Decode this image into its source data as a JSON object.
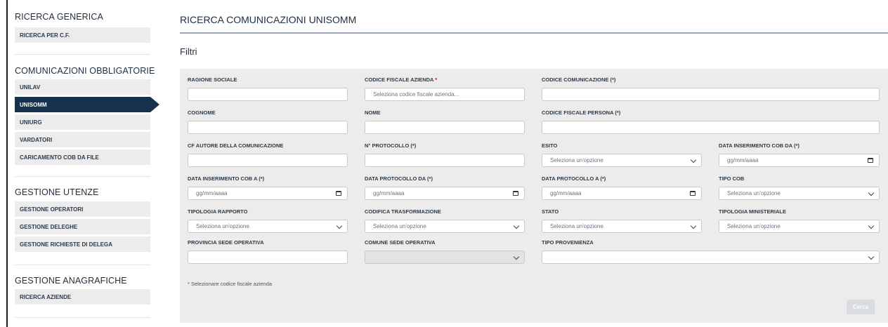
{
  "sidebar": {
    "groups": [
      {
        "title": "RICERCA GENERICA",
        "items": [
          "RICERCA PER C.F."
        ]
      },
      {
        "title": "COMUNICAZIONI OBBLIGATORIE",
        "items": [
          "UNILAV",
          "UNISOMM",
          "UNIURG",
          "VARDATORI",
          "CARICAMENTO COB DA FILE"
        ]
      },
      {
        "title": "GESTIONE UTENZE",
        "items": [
          "GESTIONE OPERATORI",
          "GESTIONE DELEGHE",
          "GESTIONE RICHIESTE DI DELEGA"
        ]
      },
      {
        "title": "GESTIONE ANAGRAFICHE",
        "items": [
          "RICERCA AZIENDE"
        ]
      }
    ],
    "active_item": "UNISOMM"
  },
  "main": {
    "page_title": "RICERCA COMUNICAZIONI UNISOMM",
    "filters_title": "Filtri",
    "fields": {
      "ragione_sociale": {
        "label": "RAGIONE SOCIALE",
        "value": ""
      },
      "codice_fiscale_azienda": {
        "label": "CODICE FISCALE AZIENDA",
        "required_mark": "*",
        "placeholder": "Seleziona codice fiscale azienda..."
      },
      "codice_comunicazione": {
        "label": "CODICE COMUNICAZIONE (*)",
        "value": ""
      },
      "cognome": {
        "label": "COGNOME",
        "value": ""
      },
      "nome": {
        "label": "NOME",
        "value": ""
      },
      "codice_fiscale_persona": {
        "label": "CODICE FISCALE PERSONA (*)",
        "value": ""
      },
      "cf_autore": {
        "label": "CF AUTORE DELLA COMUNICAZIONE",
        "value": ""
      },
      "n_protocollo": {
        "label": "N° PROTOCOLLO (*)",
        "value": ""
      },
      "esito": {
        "label": "ESITO",
        "value": "Seleziona un'opzione"
      },
      "data_ins_da": {
        "label": "DATA INSERIMENTO COB DA (*)",
        "value": "gg/mm/aaaa"
      },
      "data_ins_a": {
        "label": "DATA INSERIMENTO COB A (*)",
        "value": "gg/mm/aaaa"
      },
      "data_prot_da": {
        "label": "DATA PROTOCOLLO DA (*)",
        "value": "gg/mm/aaaa"
      },
      "data_prot_a": {
        "label": "DATA PROTOCOLLO A (*)",
        "value": "gg/mm/aaaa"
      },
      "tipo_cob": {
        "label": "TIPO COB",
        "value": "Seleziona un'opzione"
      },
      "tipologia_rapporto": {
        "label": "TIPOLOGIA RAPPORTO",
        "value": "Seleziona un'opzione"
      },
      "codifica_trasformazione": {
        "label": "CODIFICA TRASFORMAZIONE",
        "value": "Seleziona un'opzione"
      },
      "stato": {
        "label": "STATO",
        "value": "Seleziona un'opzione"
      },
      "tipologia_ministeriale": {
        "label": "TIPOLOGIA MINISTERIALE",
        "value": "Seleziona un'opzione"
      },
      "provincia_sede": {
        "label": "PROVINCIA SEDE OPERATIVA",
        "value": ""
      },
      "comune_sede": {
        "label": "COMUNE SEDE OPERATIVA",
        "value": ""
      },
      "tipo_provenienza": {
        "label": "TIPO PROVENIENZA",
        "value": ""
      }
    },
    "note": "* Selezionare codice fiscale azienda",
    "search_button": "Cerca"
  },
  "colors": {
    "active_nav": "#17324d",
    "panel_bg": "#ececec",
    "required": "#d0021b"
  }
}
